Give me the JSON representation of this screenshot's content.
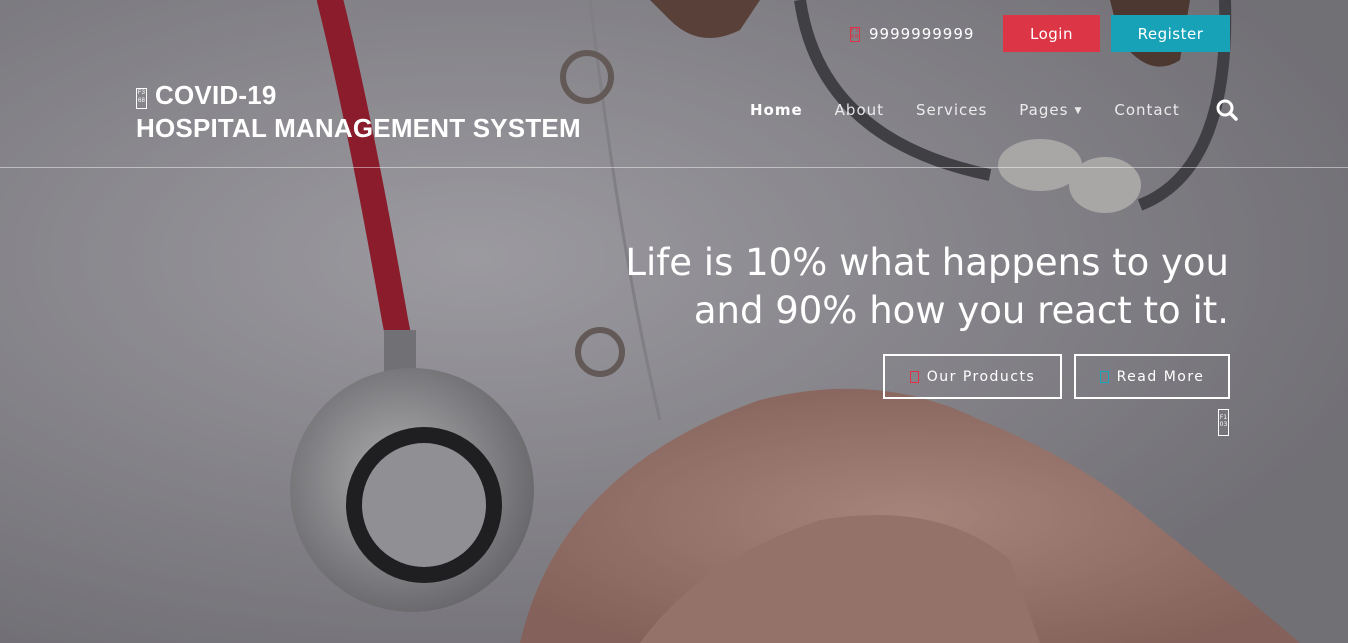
{
  "topbar": {
    "phone_icon": "phone-icon",
    "phone": "9999999999",
    "login_label": "Login",
    "register_label": "Register"
  },
  "brand": {
    "icon": "hospital-icon",
    "line1": "COVID-19",
    "line2": "HOSPITAL MANAGEMENT SYSTEM"
  },
  "nav": {
    "items": [
      {
        "label": "Home",
        "active": true
      },
      {
        "label": "About"
      },
      {
        "label": "Services"
      },
      {
        "label": "Pages",
        "dropdown": true
      },
      {
        "label": "Contact"
      }
    ],
    "search_icon": "search-icon"
  },
  "hero": {
    "headline_line1": "Life is 10% what happens to you",
    "headline_line2": "and 90% how you react to it.",
    "cta_products": "Our Products",
    "cta_read_more": "Read More",
    "scroll_icon": "scroll-down-icon"
  },
  "colors": {
    "login": "#dc3545",
    "register": "#17a2b8",
    "accent_red": "#e03046",
    "accent_teal": "#19a5bd"
  }
}
